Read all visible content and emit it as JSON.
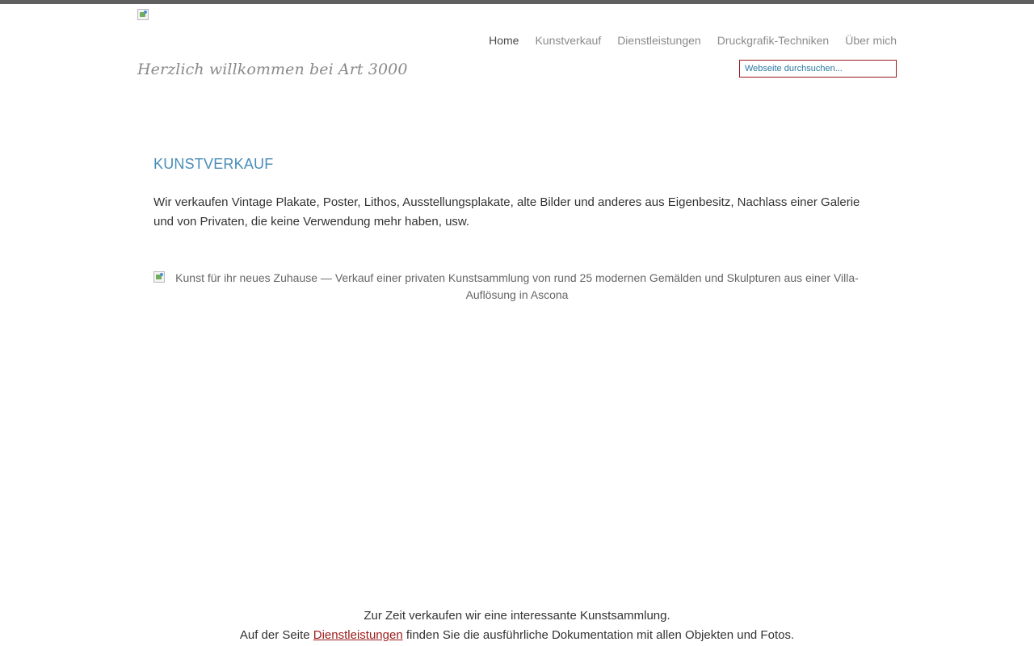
{
  "header": {
    "logo_icon": "broken-image-icon",
    "nav": [
      {
        "label": "Home",
        "active": true
      },
      {
        "label": "Kunstverkauf",
        "active": false
      },
      {
        "label": "Dienstleistungen",
        "active": false
      },
      {
        "label": "Druckgrafik-Techniken",
        "active": false
      },
      {
        "label": "Über mich",
        "active": false
      }
    ],
    "tagline": "Herzlich willkommen bei Art 3000",
    "search_placeholder": "Webseite durchsuchen..."
  },
  "main": {
    "title": "KUNSTVERKAUF",
    "intro": "Wir verkaufen Vintage Plakate, Poster, Lithos, Ausstellungsplakate, alte Bilder und anderes aus Eigenbesitz, Nachlass einer Galerie und von Privaten, die keine Verwendung mehr haben, usw.",
    "image_alt": "Kunst für ihr neues Zuhause — Verkauf einer privaten Kunstsammlung von rund 25 modernen Gemälden und Skulpturen aus einer Villa-Auflösung in Ascona"
  },
  "footer": {
    "line1": "Zur Zeit verkaufen wir eine interessante Kunstsammlung.",
    "line2_prefix": "Auf der Seite ",
    "line2_link": "Dienstleistungen",
    "line2_suffix": " finden Sie die ausführliche Dokumentation mit allen Objekten und Fotos."
  },
  "colors": {
    "topbar": "#5f5f5f",
    "accent_title": "#4a8db7",
    "link": "#9b1b1b",
    "search_border": "#9b1b1b"
  }
}
